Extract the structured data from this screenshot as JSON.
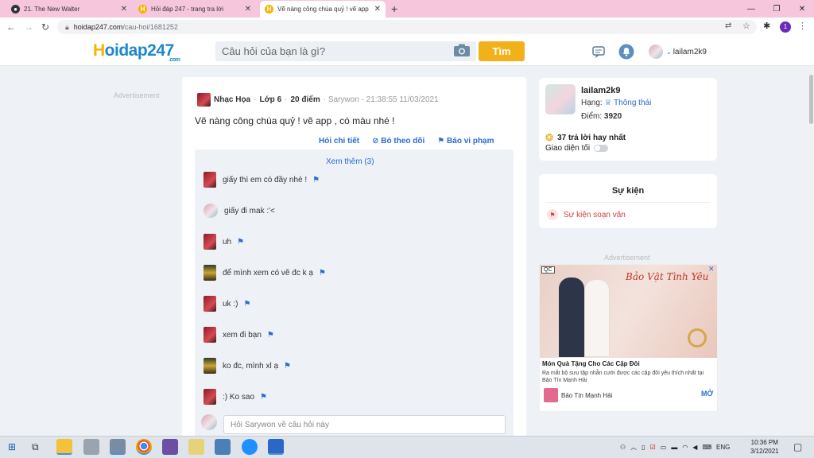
{
  "browser": {
    "tabs": [
      {
        "title": "21. The New Walter",
        "active": false
      },
      {
        "title": "Hỏi đáp 247 - trang tra lời",
        "active": false
      },
      {
        "title": "Vẽ nàng công chúa quỷ ! vẽ app",
        "active": true
      }
    ],
    "new_tab": "+",
    "url_domain": "hoidap247.com",
    "url_path": "/cau-hoi/1681252",
    "profile_initial": "1"
  },
  "site": {
    "logo": "Hoidap247",
    "logo_suffix": ".com",
    "search_placeholder": "Câu hỏi của bạn là gì?",
    "search_button": "Tìm",
    "username": "lailam2k9"
  },
  "question": {
    "ad_left": "Advertisement",
    "subject": "Nhạc Họa",
    "grade": "Lớp 6",
    "points": "20 điểm",
    "author_time": "· Sarywon - 21:38:55 11/03/2021",
    "text": "Vẽ nàng công chúa quỷ ! vẽ app , có màu nhé !",
    "actions": {
      "detail": "Hỏi chi tiết",
      "unfollow": "Bỏ theo dõi",
      "report": "Báo vi phạm"
    },
    "see_more": "Xem thêm (3)",
    "comments": [
      {
        "text": "giấy thì em có đầy nhé !",
        "flag": true,
        "avatar": "red"
      },
      {
        "text": "giấy đi mak :'<",
        "flag": false,
        "avatar": "pink"
      },
      {
        "text": "uh",
        "flag": true,
        "avatar": "red"
      },
      {
        "text": "để mình xem có vẽ đc k ạ",
        "flag": true,
        "avatar": "gold"
      },
      {
        "text": "uk :)",
        "flag": true,
        "avatar": "red"
      },
      {
        "text": "xem đi bạn",
        "flag": true,
        "avatar": "red"
      },
      {
        "text": "ko đc, mình xl ạ",
        "flag": true,
        "avatar": "gold"
      },
      {
        "text": ":) Ko sao",
        "flag": true,
        "avatar": "red"
      }
    ],
    "reply_placeholder": "Hỏi Sarywon về câu hỏi này"
  },
  "profile": {
    "name": "lailam2k9",
    "rank_label": "Hạng:",
    "rank_value": "Thông thái",
    "points_label": "Điểm:",
    "points_value": "3920",
    "best_answers": "37 trả lời hay nhất",
    "theme_label": "Giao diện tối"
  },
  "events": {
    "title": "Sự kiện",
    "item": "Sự kiện soạn văn"
  },
  "ad": {
    "label": "Advertisement",
    "qc": "QC",
    "headline": "Bảo Vật Tình Yêu",
    "title": "Món Quà Tặng Cho Các Cặp Đôi",
    "desc": "Ra mắt bộ sưu tập nhẫn cưới được các cặp đôi yêu thích nhất tại Bảo Tín Mạnh Hải",
    "brand": "Bảo Tín Mạnh Hải",
    "cta": "MỞ"
  },
  "taskbar": {
    "lang": "ENG",
    "time": "10:36 PM",
    "date": "3/12/2021"
  }
}
